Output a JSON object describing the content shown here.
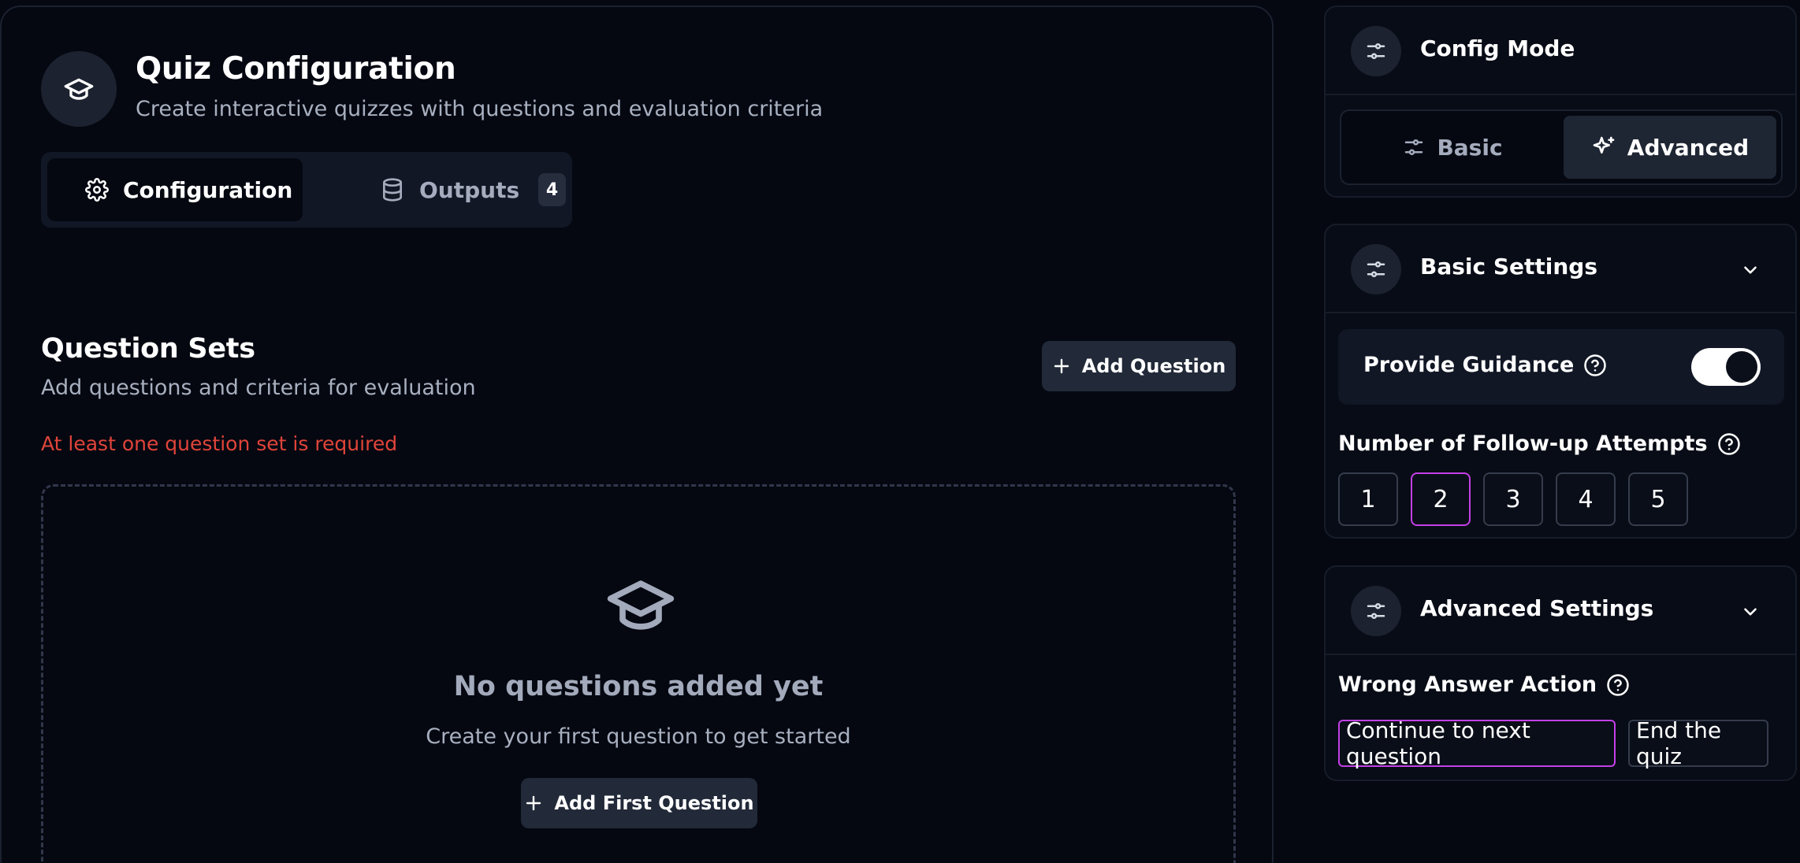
{
  "header": {
    "icon": "graduation-cap-icon",
    "title": "Quiz Configuration",
    "subtitle": "Create interactive quizzes with questions and evaluation criteria"
  },
  "tabs": [
    {
      "label": "Configuration",
      "icon": "gear-icon",
      "active": true
    },
    {
      "label": "Outputs",
      "icon": "database-icon",
      "badge": "4",
      "active": false
    }
  ],
  "question_sets": {
    "title": "Question Sets",
    "subtitle": "Add questions and criteria for evaluation",
    "add_button": "Add Question",
    "error": "At least one question set is required",
    "empty_title": "No questions added yet",
    "empty_subtitle": "Create your first question to get started",
    "add_first_button": "Add First Question"
  },
  "config_mode": {
    "title": "Config Mode",
    "options": [
      {
        "label": "Basic",
        "icon": "sliders-icon",
        "selected": false
      },
      {
        "label": "Advanced",
        "icon": "sparkles-icon",
        "selected": true
      }
    ]
  },
  "basic_settings": {
    "title": "Basic Settings",
    "guidance_label": "Provide Guidance",
    "guidance_enabled": true,
    "attempts_label": "Number of Follow-up Attempts",
    "attempt_options": [
      "1",
      "2",
      "3",
      "4",
      "5"
    ],
    "attempts_selected": "2"
  },
  "advanced_settings": {
    "title": "Advanced Settings",
    "wrong_answer_label": "Wrong Answer Action",
    "wrong_answer_options": [
      "Continue to next question",
      "End the quiz"
    ],
    "wrong_answer_selected": "Continue to next question"
  },
  "colors": {
    "background": "#050811",
    "accent_selected": "#c340e6",
    "error": "#e0443a"
  }
}
